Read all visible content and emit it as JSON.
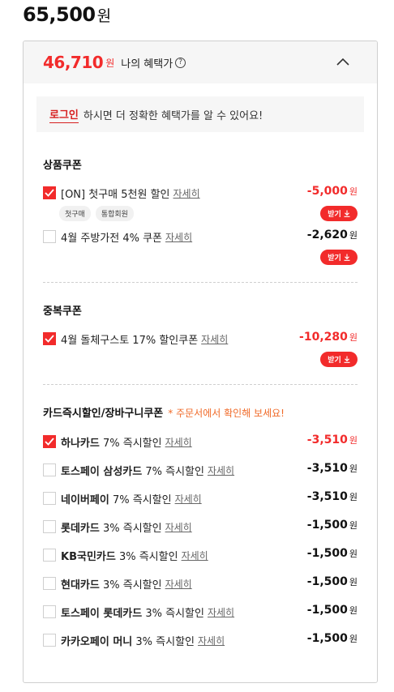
{
  "price": {
    "value": "65,500",
    "unit": "원"
  },
  "benefit": {
    "value": "46,710",
    "unit": "원",
    "label": "나의 혜택가",
    "help_icon": "?"
  },
  "login": {
    "link": "로그인",
    "message": "하시면 더 정확한 혜택가를 알 수 있어요!"
  },
  "detail_label": "자세히",
  "download_label": "받기",
  "sections": {
    "product_coupon": {
      "title": "상품쿠폰",
      "items": [
        {
          "label": "[ON] 첫구매 5천원 할인",
          "amount": "-5,000",
          "unit": "원",
          "checked": true,
          "tags": [
            "첫구매",
            "통합회원"
          ]
        },
        {
          "label": "4월 주방가전 4% 쿠폰",
          "amount": "-2,620",
          "unit": "원",
          "checked": false
        }
      ]
    },
    "stack_coupon": {
      "title": "중복쿠폰",
      "items": [
        {
          "label": "4월 돌체구스토 17% 할인쿠폰",
          "amount": "-10,280",
          "unit": "원",
          "checked": true
        }
      ]
    },
    "card_discount": {
      "title": "카드즉시할인/장바구니쿠폰",
      "note": "* 주문서에서 확인해 보세요!",
      "items": [
        {
          "name": "하나카드",
          "desc": "7% 즉시할인",
          "amount": "-3,510",
          "unit": "원",
          "checked": true
        },
        {
          "name": "토스페이 삼성카드",
          "desc": "7% 즉시할인",
          "amount": "-3,510",
          "unit": "원",
          "checked": false
        },
        {
          "name": "네이버페이",
          "desc": "7% 즉시할인",
          "amount": "-3,510",
          "unit": "원",
          "checked": false
        },
        {
          "name": "롯데카드",
          "desc": "3% 즉시할인",
          "amount": "-1,500",
          "unit": "원",
          "checked": false
        },
        {
          "name": "KB국민카드",
          "desc": "3% 즉시할인",
          "amount": "-1,500",
          "unit": "원",
          "checked": false
        },
        {
          "name": "현대카드",
          "desc": "3% 즉시할인",
          "amount": "-1,500",
          "unit": "원",
          "checked": false
        },
        {
          "name": "토스페이 롯데카드",
          "desc": "3% 즉시할인",
          "amount": "-1,500",
          "unit": "원",
          "checked": false
        },
        {
          "name": "카카오페이 머니",
          "desc": "3% 즉시할인",
          "amount": "-1,500",
          "unit": "원",
          "checked": false
        }
      ]
    }
  },
  "colors": {
    "accent": "#f22b2b",
    "note": "#f06a28",
    "panel_bg": "#f6f6f6"
  },
  "icons": {
    "collapse": "chevron-up-icon",
    "check": "check-icon",
    "download": "download-icon",
    "help": "help-icon"
  }
}
